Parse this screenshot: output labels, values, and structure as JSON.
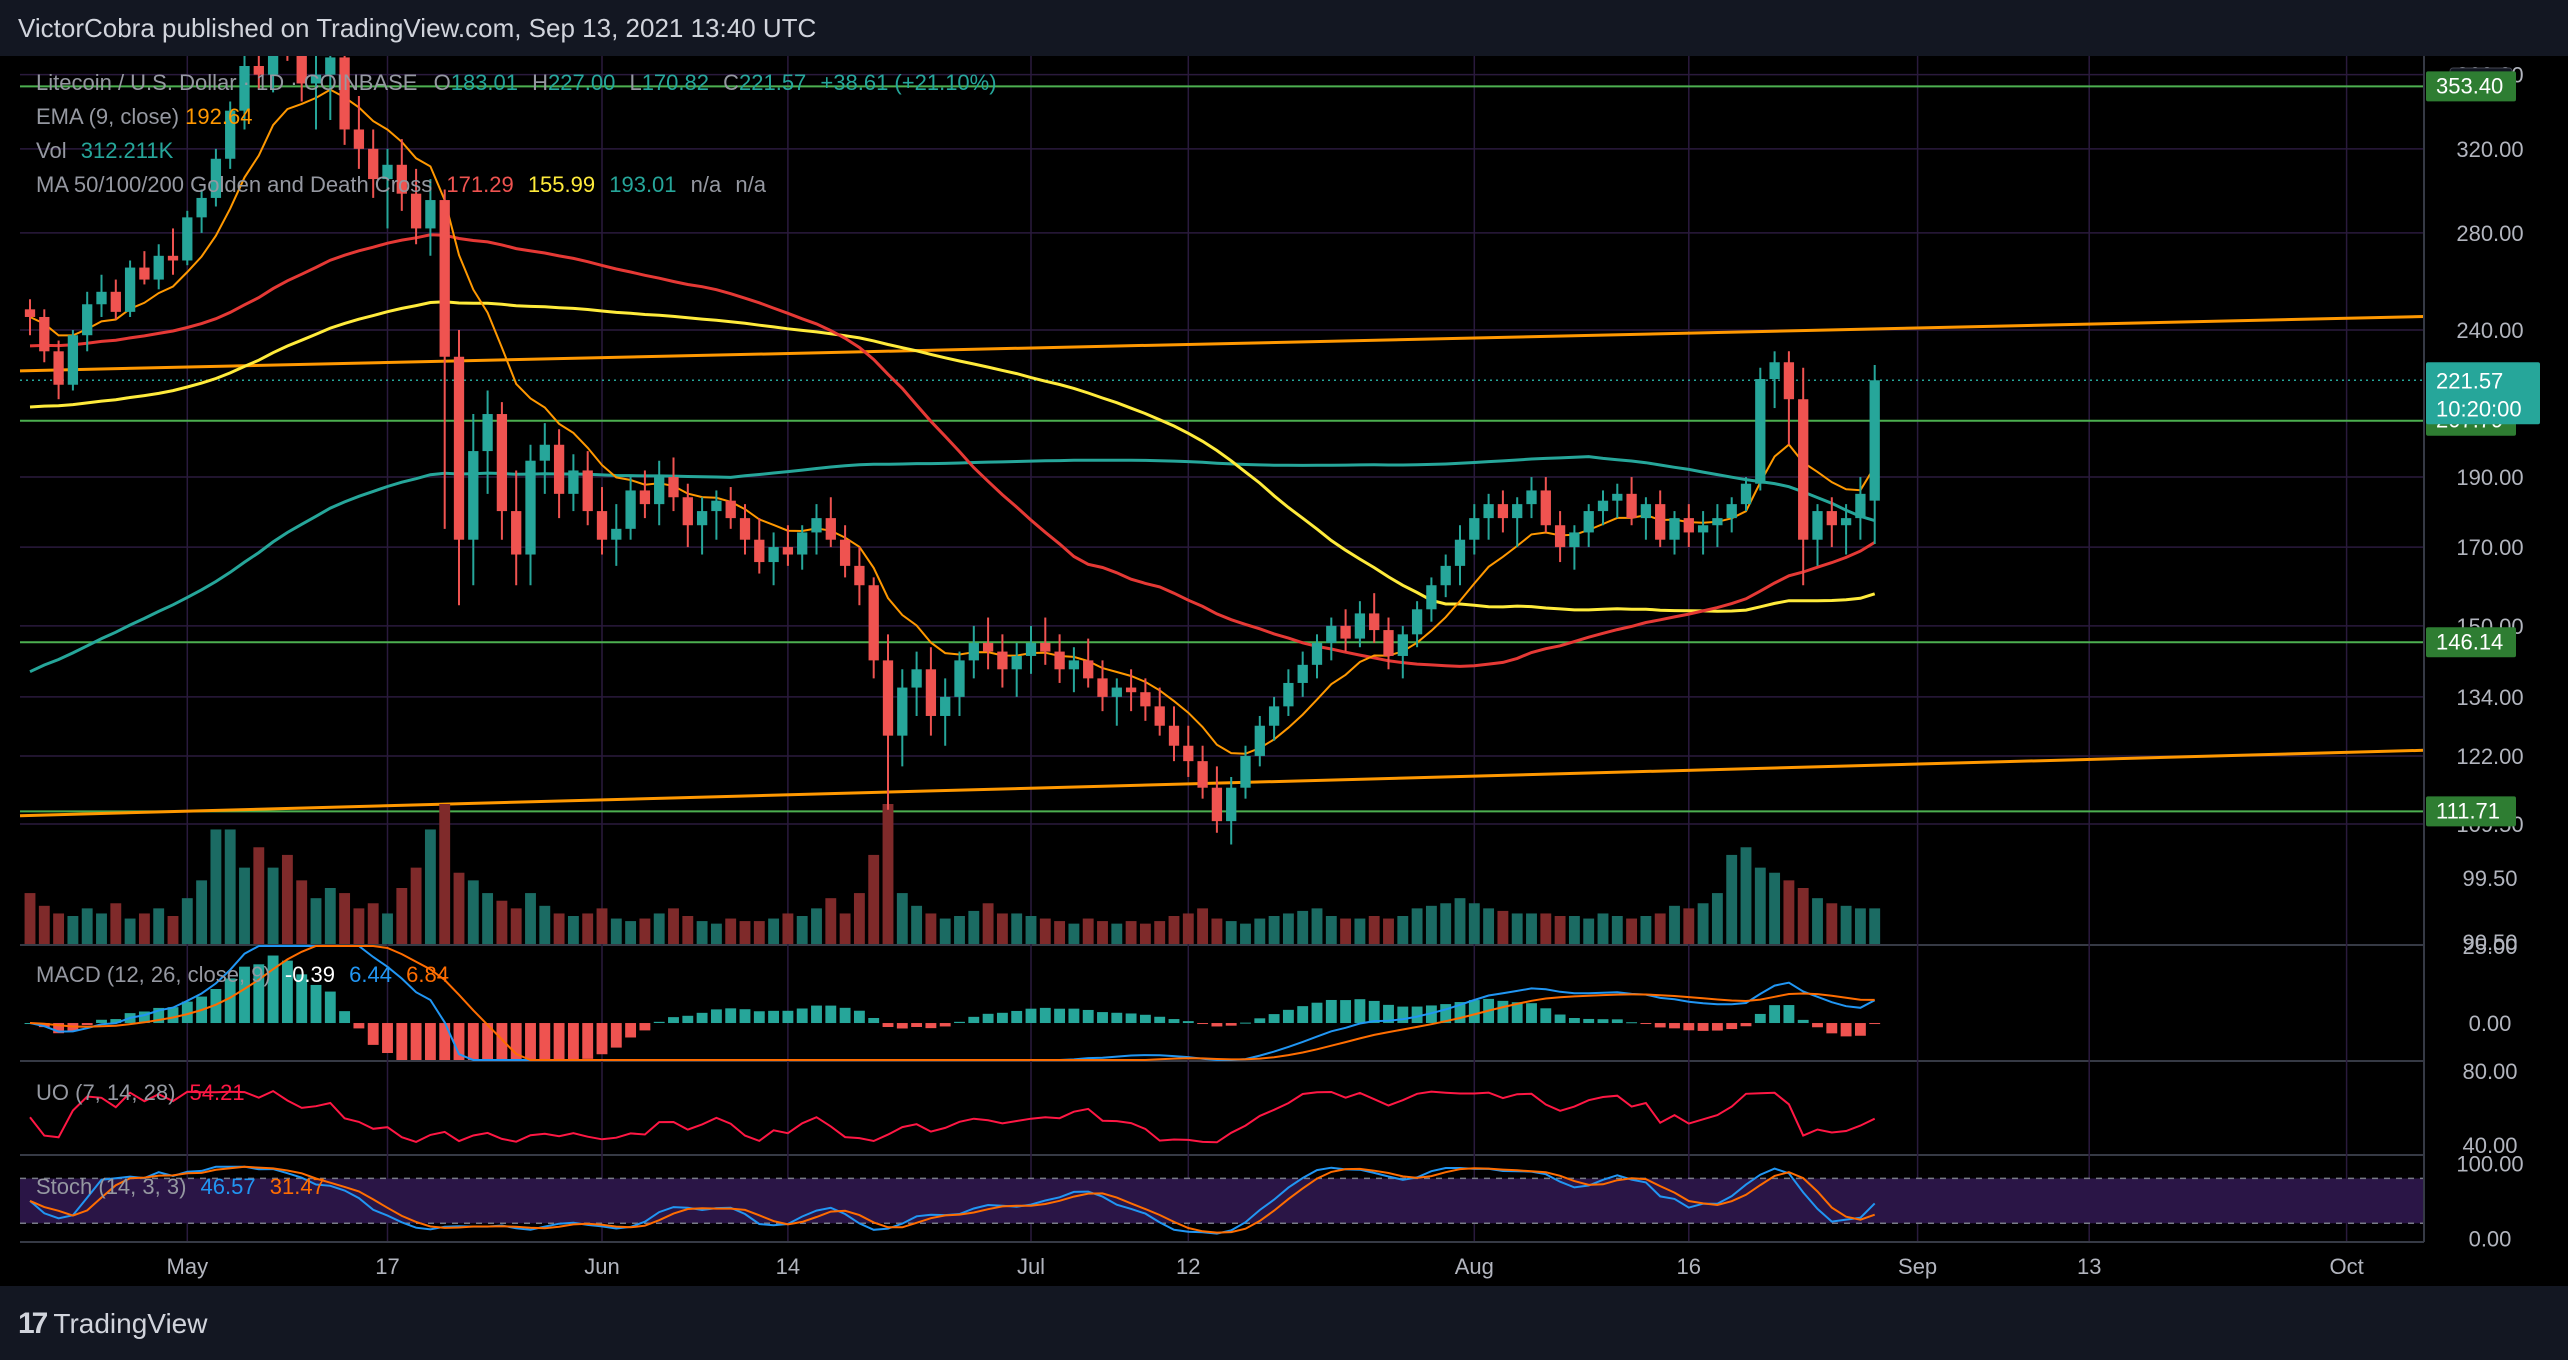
{
  "header": {
    "text": "VictorCobra published on TradingView.com, Sep 13, 2021 13:40 UTC"
  },
  "footer": {
    "brand": "TradingView"
  },
  "colors": {
    "bg": "#000000",
    "grid": "#2a1a3d",
    "up": "#26a69a",
    "down": "#ef5350",
    "ema": "#ff9800",
    "ma50": "#e53935",
    "ma100": "#ffeb3b",
    "ma200": "#26a69a",
    "hline": "#4caf50",
    "trend": "#ff9800",
    "macd": "#2196f3",
    "signal": "#ff6d00",
    "uo": "#ff1744",
    "stochK": "#2196f3",
    "stochD": "#ff6d00"
  },
  "legend": {
    "symbol": "Litecoin / U.S. Dollar · 1D · COINBASE",
    "o_label": "O",
    "o": "183.01",
    "h_label": "H",
    "h": "227.00",
    "l_label": "L",
    "l": "170.82",
    "c_label": "C",
    "c": "221.57",
    "change": "+38.61 (+21.10%)",
    "ema_label": "EMA (9, close)",
    "ema_val": "192.64",
    "vol_label": "Vol",
    "vol_val": "312.211K",
    "ma_label": "MA 50/100/200 Golden and Death Cross",
    "ma50": "171.29",
    "ma100": "155.99",
    "ma200": "193.01",
    "na1": "n/a",
    "na2": "n/a",
    "macd_label": "MACD (12, 26, close, 9)",
    "macd_h": "-0.39",
    "macd_v": "6.44",
    "macd_s": "6.84",
    "uo_label": "UO (7, 14, 28)",
    "uo_v": "54.21",
    "stoch_label": "Stoch (14, 3, 3)",
    "stoch_k": "46.57",
    "stoch_d": "31.47"
  },
  "price_axis": {
    "currency": "USD",
    "ticks": [
      "360.00",
      "320.00",
      "280.00",
      "240.00",
      "190.00",
      "170.00",
      "150.00",
      "134.00",
      "122.00",
      "109.50",
      "99.50",
      "90.50"
    ],
    "last_price": "221.57",
    "countdown": "10:20:00",
    "level_labels": [
      "353.40",
      "207.79",
      "146.14",
      "111.71"
    ]
  },
  "macd_axis": {
    "ticks": [
      "25.00",
      "0.00"
    ]
  },
  "uo_axis": {
    "ticks": [
      "80.00",
      "40.00"
    ]
  },
  "stoch_axis": {
    "ticks": [
      "100.00",
      "0.00"
    ]
  },
  "time_axis": {
    "labels": [
      "May",
      "17",
      "Jun",
      "14",
      "Jul",
      "12",
      "Aug",
      "16",
      "Sep",
      "13",
      "Oct"
    ]
  },
  "chart_data": {
    "type": "candlestick",
    "symbol": "LTC/USD",
    "exchange": "COINBASE",
    "start_date": "2021-04-22",
    "interval": "1D",
    "price_scale": "log",
    "ylim": [
      90.5,
      365
    ],
    "ohlc": [
      [
        248,
        252,
        238,
        245
      ],
      [
        245,
        248,
        228,
        232
      ],
      [
        232,
        236,
        215,
        220
      ],
      [
        220,
        240,
        218,
        238
      ],
      [
        238,
        255,
        232,
        250
      ],
      [
        250,
        262,
        245,
        255
      ],
      [
        255,
        260,
        244,
        247
      ],
      [
        247,
        268,
        245,
        265
      ],
      [
        265,
        272,
        258,
        260
      ],
      [
        260,
        275,
        256,
        270
      ],
      [
        270,
        282,
        262,
        268
      ],
      [
        268,
        290,
        266,
        287
      ],
      [
        287,
        300,
        280,
        296
      ],
      [
        296,
        320,
        292,
        315
      ],
      [
        315,
        345,
        310,
        340
      ],
      [
        340,
        372,
        330,
        365
      ],
      [
        365,
        385,
        352,
        360
      ],
      [
        360,
        400,
        350,
        395
      ],
      [
        395,
        410,
        368,
        375
      ],
      [
        375,
        390,
        345,
        355
      ],
      [
        355,
        375,
        330,
        360
      ],
      [
        360,
        385,
        335,
        370
      ],
      [
        370,
        380,
        322,
        330
      ],
      [
        330,
        348,
        310,
        320
      ],
      [
        320,
        330,
        296,
        305
      ],
      [
        305,
        320,
        282,
        312
      ],
      [
        312,
        325,
        290,
        298
      ],
      [
        298,
        310,
        275,
        282
      ],
      [
        282,
        305,
        270,
        295
      ],
      [
        295,
        300,
        175,
        230
      ],
      [
        230,
        240,
        155,
        172
      ],
      [
        172,
        210,
        160,
        198
      ],
      [
        198,
        218,
        185,
        210
      ],
      [
        210,
        214,
        172,
        180
      ],
      [
        180,
        192,
        160,
        168
      ],
      [
        168,
        200,
        160,
        195
      ],
      [
        195,
        207,
        185,
        200
      ],
      [
        200,
        205,
        178,
        185
      ],
      [
        185,
        197,
        180,
        192
      ],
      [
        192,
        198,
        176,
        180
      ],
      [
        180,
        187,
        168,
        172
      ],
      [
        172,
        182,
        165,
        175
      ],
      [
        175,
        190,
        172,
        186
      ],
      [
        186,
        192,
        178,
        182
      ],
      [
        182,
        195,
        176,
        190
      ],
      [
        190,
        196,
        180,
        184
      ],
      [
        184,
        188,
        170,
        176
      ],
      [
        176,
        184,
        168,
        180
      ],
      [
        180,
        186,
        172,
        183
      ],
      [
        183,
        187,
        175,
        178
      ],
      [
        178,
        182,
        168,
        172
      ],
      [
        172,
        178,
        163,
        166
      ],
      [
        166,
        174,
        160,
        170
      ],
      [
        170,
        176,
        165,
        168
      ],
      [
        168,
        176,
        164,
        174
      ],
      [
        174,
        182,
        168,
        178
      ],
      [
        178,
        184,
        170,
        172
      ],
      [
        172,
        176,
        162,
        165
      ],
      [
        165,
        170,
        155,
        160
      ],
      [
        160,
        162,
        138,
        142
      ],
      [
        142,
        148,
        112,
        126
      ],
      [
        126,
        140,
        120,
        136
      ],
      [
        136,
        144,
        130,
        140
      ],
      [
        140,
        145,
        126,
        130
      ],
      [
        130,
        138,
        124,
        134
      ],
      [
        134,
        144,
        130,
        142
      ],
      [
        142,
        150,
        138,
        146
      ],
      [
        146,
        152,
        140,
        144
      ],
      [
        144,
        148,
        136,
        140
      ],
      [
        140,
        146,
        134,
        143
      ],
      [
        143,
        150,
        139,
        146
      ],
      [
        146,
        152,
        141,
        144
      ],
      [
        144,
        148,
        137,
        140
      ],
      [
        140,
        145,
        135,
        142
      ],
      [
        142,
        147,
        136,
        138
      ],
      [
        138,
        142,
        131,
        134
      ],
      [
        134,
        138,
        128,
        136
      ],
      [
        136,
        140,
        131,
        135
      ],
      [
        135,
        138,
        129,
        132
      ],
      [
        132,
        136,
        126,
        128
      ],
      [
        128,
        132,
        121,
        124
      ],
      [
        124,
        128,
        118,
        121
      ],
      [
        121,
        124,
        114,
        116
      ],
      [
        116,
        120,
        108,
        110
      ],
      [
        110,
        118,
        106,
        116
      ],
      [
        116,
        124,
        114,
        122
      ],
      [
        122,
        130,
        120,
        128
      ],
      [
        128,
        134,
        125,
        132
      ],
      [
        132,
        140,
        130,
        137
      ],
      [
        137,
        144,
        134,
        141
      ],
      [
        141,
        148,
        138,
        146
      ],
      [
        146,
        152,
        142,
        150
      ],
      [
        150,
        154,
        144,
        147
      ],
      [
        147,
        156,
        145,
        153
      ],
      [
        153,
        158,
        146,
        149
      ],
      [
        149,
        152,
        140,
        143
      ],
      [
        143,
        150,
        138,
        148
      ],
      [
        148,
        156,
        145,
        154
      ],
      [
        154,
        162,
        151,
        160
      ],
      [
        160,
        168,
        157,
        165
      ],
      [
        165,
        176,
        160,
        172
      ],
      [
        172,
        182,
        168,
        178
      ],
      [
        178,
        185,
        172,
        182
      ],
      [
        182,
        186,
        174,
        178
      ],
      [
        178,
        184,
        170,
        182
      ],
      [
        182,
        190,
        178,
        186
      ],
      [
        186,
        190,
        174,
        176
      ],
      [
        176,
        180,
        166,
        170
      ],
      [
        170,
        176,
        164,
        174
      ],
      [
        174,
        182,
        170,
        180
      ],
      [
        180,
        186,
        176,
        183
      ],
      [
        183,
        188,
        178,
        185
      ],
      [
        185,
        190,
        176,
        178
      ],
      [
        178,
        184,
        172,
        182
      ],
      [
        182,
        186,
        170,
        172
      ],
      [
        172,
        180,
        168,
        178
      ],
      [
        178,
        182,
        170,
        174
      ],
      [
        174,
        180,
        168,
        176
      ],
      [
        176,
        182,
        170,
        178
      ],
      [
        178,
        184,
        174,
        182
      ],
      [
        182,
        190,
        180,
        188
      ],
      [
        188,
        226,
        186,
        222
      ],
      [
        222,
        232,
        212,
        228
      ],
      [
        228,
        232,
        200,
        215
      ],
      [
        215,
        226,
        160,
        172
      ],
      [
        172,
        182,
        165,
        180
      ],
      [
        180,
        184,
        170,
        176
      ],
      [
        176,
        182,
        168,
        178
      ],
      [
        178,
        190,
        172,
        185
      ],
      [
        183.01,
        227,
        170.82,
        221.57
      ]
    ],
    "volume": [
      20,
      15,
      12,
      11,
      14,
      12,
      16,
      10,
      12,
      14,
      11,
      18,
      25,
      45,
      45,
      30,
      38,
      30,
      35,
      25,
      18,
      22,
      20,
      14,
      16,
      12,
      22,
      30,
      45,
      55,
      28,
      25,
      20,
      17,
      14,
      20,
      15,
      12,
      11,
      12,
      14,
      10,
      9,
      10,
      12,
      14,
      11,
      9,
      8,
      10,
      9,
      9,
      10,
      12,
      11,
      14,
      18,
      12,
      20,
      35,
      55,
      20,
      15,
      12,
      10,
      11,
      13,
      16,
      12,
      12,
      11,
      10,
      9,
      8,
      10,
      9,
      8,
      9,
      8,
      9,
      11,
      12,
      14,
      10,
      9,
      8,
      10,
      11,
      12,
      13,
      14,
      11,
      10,
      10,
      11,
      10,
      11,
      14,
      15,
      16,
      18,
      16,
      14,
      13,
      12,
      12,
      12,
      11,
      11,
      10,
      12,
      11,
      10,
      11,
      12,
      15,
      14,
      16,
      20,
      35,
      38,
      30,
      28,
      25,
      22,
      18,
      16,
      15,
      14,
      14
    ],
    "ema": {
      "period": 9,
      "source": "close",
      "last": 192.64
    },
    "ma": {
      "50": 171.29,
      "100": 155.99,
      "200": 193.01
    },
    "horizontal_levels": [
      353.4,
      207.79,
      146.14,
      111.71
    ],
    "trendlines": [
      {
        "from": [
          "2021-04-22",
          225
        ],
        "to": [
          "2021-10-05",
          245
        ]
      },
      {
        "from": [
          "2021-04-22",
          111
        ],
        "to": [
          "2021-10-05",
          123
        ]
      }
    ],
    "macd": {
      "fast": 12,
      "slow": 26,
      "signal": 9,
      "hist": -0.39,
      "macd": 6.44,
      "signal_value": 6.84,
      "ylim": [
        -12,
        25
      ]
    },
    "uo": {
      "periods": [
        7,
        14,
        28
      ],
      "value": 54.21,
      "ylim": [
        35,
        85
      ]
    },
    "stoch": {
      "k": 46.57,
      "d": 31.47,
      "ylim": [
        -5,
        110
      ],
      "bands": [
        80,
        20
      ]
    }
  }
}
